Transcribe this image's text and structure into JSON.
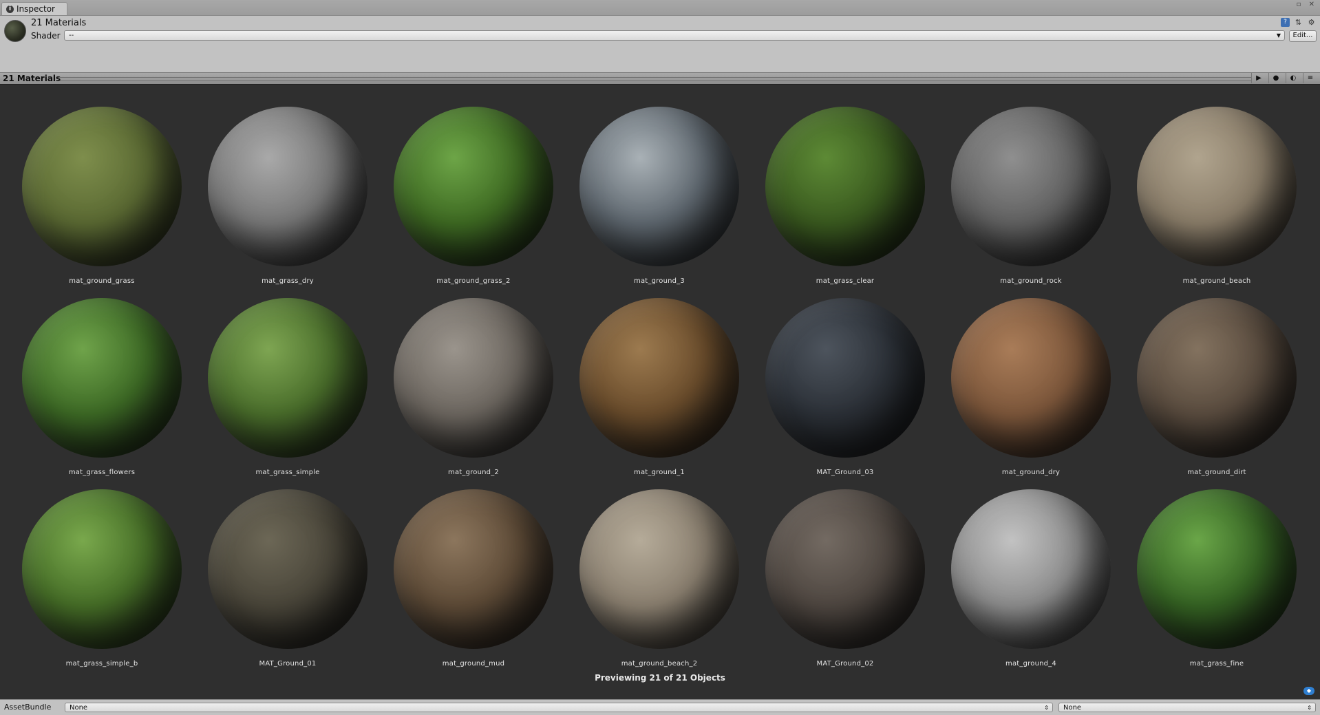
{
  "window": {
    "tab_label": "Inspector",
    "tab_icon": "info-icon",
    "controls": "▫ ✕"
  },
  "header": {
    "title": "21 Materials",
    "shader_label": "Shader",
    "shader_value": "--",
    "edit_button": "Edit...",
    "icons": [
      "help-book-icon",
      "preset-icon",
      "settings-gear-icon"
    ]
  },
  "preview": {
    "title": "21 Materials",
    "buttons": [
      "play-icon",
      "sphere-preview-icon",
      "lighting-icon",
      "menu-icon"
    ],
    "status": "Previewing 21 of 21 Objects",
    "materials": [
      {
        "name": "mat_ground_grass",
        "color": "#5b6a33",
        "hi": "#7e8e4c"
      },
      {
        "name": "mat_grass_dry",
        "color": "#787878",
        "hi": "#a9a9a9"
      },
      {
        "name": "mat_ground_grass_2",
        "color": "#3e6a22",
        "hi": "#6da547"
      },
      {
        "name": "mat_ground_3",
        "color": "#5f6870",
        "hi": "#a9b1b6"
      },
      {
        "name": "mat_grass_clear",
        "color": "#3a5a1f",
        "hi": "#5d8a35"
      },
      {
        "name": "mat_ground_rock",
        "color": "#626262",
        "hi": "#8f8f8f"
      },
      {
        "name": "mat_ground_beach",
        "color": "#8a7d69",
        "hi": "#b0a48e"
      },
      {
        "name": "mat_grass_flowers",
        "color": "#3d6a25",
        "hi": "#6fa34a"
      },
      {
        "name": "mat_grass_simple",
        "color": "#4a6e2b",
        "hi": "#7ea552"
      },
      {
        "name": "mat_ground_2",
        "color": "#6d6760",
        "hi": "#9a948c"
      },
      {
        "name": "mat_ground_1",
        "color": "#6b4d2c",
        "hi": "#9c7a4f"
      },
      {
        "name": "MAT_Ground_03",
        "color": "#2c3138",
        "hi": "#4d545d"
      },
      {
        "name": "mat_ground_dry",
        "color": "#7d573b",
        "hi": "#a97c58"
      },
      {
        "name": "mat_ground_dirt",
        "color": "#5a4c3f",
        "hi": "#83725f"
      },
      {
        "name": "mat_grass_simple_b",
        "color": "#466e27",
        "hi": "#79a84c"
      },
      {
        "name": "MAT_Ground_01",
        "color": "#4a463a",
        "hi": "#6c6756"
      },
      {
        "name": "mat_ground_mud",
        "color": "#5e4b37",
        "hi": "#8c765d"
      },
      {
        "name": "mat_ground_beach_2",
        "color": "#8b8070",
        "hi": "#b5ab99"
      },
      {
        "name": "MAT_Ground_02",
        "color": "#4f4741",
        "hi": "#736a62"
      },
      {
        "name": "mat_ground_4",
        "color": "#8d8d8d",
        "hi": "#c2c2c2"
      },
      {
        "name": "mat_grass_fine",
        "color": "#356323",
        "hi": "#6aa648"
      }
    ]
  },
  "asset_bundle": {
    "label": "AssetBundle",
    "bundle_value": "None",
    "variant_value": "None"
  }
}
